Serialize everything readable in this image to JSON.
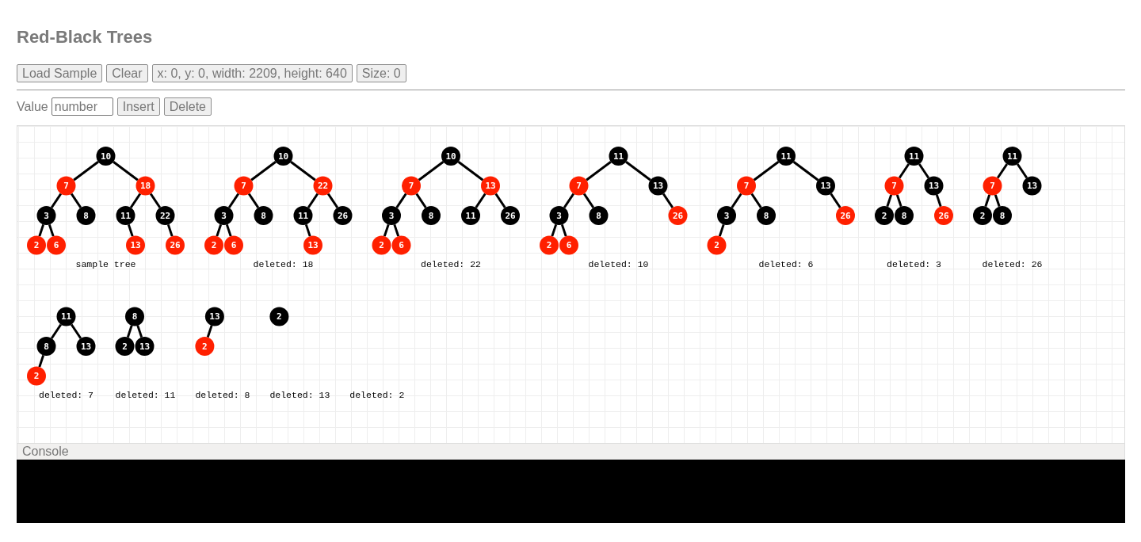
{
  "title": "Red-Black Trees",
  "toolbar": {
    "buttons": [
      "Load Sample",
      "Clear",
      "x: 0, y: 0, width: 2209, height: 640",
      "Size: 0"
    ]
  },
  "value_bar": {
    "label": "Value",
    "input": {
      "placeholder": "number"
    },
    "buttons": [
      "Insert",
      "Delete"
    ]
  },
  "trees": [
    {
      "caption": "sample tree",
      "root": {
        "value": "10",
        "color": "#000000",
        "children": [
          {
            "right": false,
            "value": "7",
            "color": "#ff2000",
            "children": [
              {
                "right": false,
                "value": "3",
                "color": "#000000",
                "children": [
                  {
                    "right": false,
                    "value": "2",
                    "color": "#ff2000"
                  },
                  {
                    "right": true,
                    "value": "6",
                    "color": "#ff2000"
                  }
                ]
              },
              {
                "right": true,
                "value": "8",
                "color": "#000000"
              }
            ]
          },
          {
            "right": true,
            "value": "18",
            "color": "#ff2000",
            "children": [
              {
                "right": false,
                "value": "11",
                "color": "#000000",
                "children": [
                  {
                    "right": true,
                    "value": "13",
                    "color": "#ff2000"
                  }
                ]
              },
              {
                "right": true,
                "value": "22",
                "color": "#000000",
                "children": [
                  {
                    "right": true,
                    "value": "26",
                    "color": "#ff2000"
                  }
                ]
              }
            ]
          }
        ]
      }
    },
    {
      "caption": "deleted: 18",
      "root": {
        "value": "10",
        "color": "#000000",
        "children": [
          {
            "right": false,
            "value": "7",
            "color": "#ff2000",
            "children": [
              {
                "right": false,
                "value": "3",
                "color": "#000000",
                "children": [
                  {
                    "right": false,
                    "value": "2",
                    "color": "#ff2000"
                  },
                  {
                    "right": true,
                    "value": "6",
                    "color": "#ff2000"
                  }
                ]
              },
              {
                "right": true,
                "value": "8",
                "color": "#000000"
              }
            ]
          },
          {
            "right": true,
            "value": "22",
            "color": "#ff2000",
            "children": [
              {
                "right": false,
                "value": "11",
                "color": "#000000",
                "children": [
                  {
                    "right": true,
                    "value": "13",
                    "color": "#ff2000"
                  }
                ]
              },
              {
                "right": true,
                "value": "26",
                "color": "#000000"
              }
            ]
          }
        ]
      }
    },
    {
      "caption": "deleted: 22",
      "root": {
        "value": "10",
        "color": "#000000",
        "children": [
          {
            "right": false,
            "value": "7",
            "color": "#ff2000",
            "children": [
              {
                "right": false,
                "value": "3",
                "color": "#000000",
                "children": [
                  {
                    "right": false,
                    "value": "2",
                    "color": "#ff2000"
                  },
                  {
                    "right": true,
                    "value": "6",
                    "color": "#ff2000"
                  }
                ]
              },
              {
                "right": true,
                "value": "8",
                "color": "#000000"
              }
            ]
          },
          {
            "right": true,
            "value": "13",
            "color": "#ff2000",
            "children": [
              {
                "right": false,
                "value": "11",
                "color": "#000000"
              },
              {
                "right": true,
                "value": "26",
                "color": "#000000"
              }
            ]
          }
        ]
      }
    },
    {
      "caption": "deleted: 10",
      "root": {
        "value": "11",
        "color": "#000000",
        "children": [
          {
            "right": false,
            "value": "7",
            "color": "#ff2000",
            "children": [
              {
                "right": false,
                "value": "3",
                "color": "#000000",
                "children": [
                  {
                    "right": false,
                    "value": "2",
                    "color": "#ff2000"
                  },
                  {
                    "right": true,
                    "value": "6",
                    "color": "#ff2000"
                  }
                ]
              },
              {
                "right": true,
                "value": "8",
                "color": "#000000"
              }
            ]
          },
          {
            "right": true,
            "value": "13",
            "color": "#000000",
            "children": [
              {
                "right": true,
                "value": "26",
                "color": "#ff2000"
              }
            ]
          }
        ]
      }
    },
    {
      "caption": "deleted: 6",
      "root": {
        "value": "11",
        "color": "#000000",
        "children": [
          {
            "right": false,
            "value": "7",
            "color": "#ff2000",
            "children": [
              {
                "right": false,
                "value": "3",
                "color": "#000000",
                "children": [
                  {
                    "right": false,
                    "value": "2",
                    "color": "#ff2000"
                  }
                ]
              },
              {
                "right": true,
                "value": "8",
                "color": "#000000"
              }
            ]
          },
          {
            "right": true,
            "value": "13",
            "color": "#000000",
            "children": [
              {
                "right": true,
                "value": "26",
                "color": "#ff2000"
              }
            ]
          }
        ]
      }
    },
    {
      "caption": "deleted: 3",
      "root": {
        "value": "11",
        "color": "#000000",
        "children": [
          {
            "right": false,
            "value": "7",
            "color": "#ff2000",
            "children": [
              {
                "right": false,
                "value": "2",
                "color": "#000000"
              },
              {
                "right": true,
                "value": "8",
                "color": "#000000"
              }
            ]
          },
          {
            "right": true,
            "value": "13",
            "color": "#000000",
            "children": [
              {
                "right": true,
                "value": "26",
                "color": "#ff2000"
              }
            ]
          }
        ]
      }
    },
    {
      "caption": "deleted: 26",
      "root": {
        "value": "11",
        "color": "#000000",
        "children": [
          {
            "right": false,
            "value": "7",
            "color": "#ff2000",
            "children": [
              {
                "right": false,
                "value": "2",
                "color": "#000000"
              },
              {
                "right": true,
                "value": "8",
                "color": "#000000"
              }
            ]
          },
          {
            "right": true,
            "value": "13",
            "color": "#000000"
          }
        ]
      }
    },
    {
      "caption": "deleted: 7",
      "root": {
        "value": "11",
        "color": "#000000",
        "children": [
          {
            "right": false,
            "value": "8",
            "color": "#000000",
            "children": [
              {
                "right": false,
                "value": "2",
                "color": "#ff2000"
              }
            ]
          },
          {
            "right": true,
            "value": "13",
            "color": "#000000"
          }
        ]
      }
    },
    {
      "caption": "deleted: 11",
      "root": {
        "value": "8",
        "color": "#000000",
        "children": [
          {
            "right": false,
            "value": "2",
            "color": "#000000"
          },
          {
            "right": true,
            "value": "13",
            "color": "#000000"
          }
        ]
      }
    },
    {
      "caption": "deleted: 8",
      "root": {
        "value": "13",
        "color": "#000000",
        "children": [
          {
            "right": false,
            "value": "2",
            "color": "#ff2000"
          }
        ]
      }
    },
    {
      "caption": "deleted: 13",
      "root": {
        "value": "2",
        "color": "#000000"
      }
    },
    {
      "caption": "deleted: 2"
    }
  ],
  "console": {
    "title": "Console"
  }
}
